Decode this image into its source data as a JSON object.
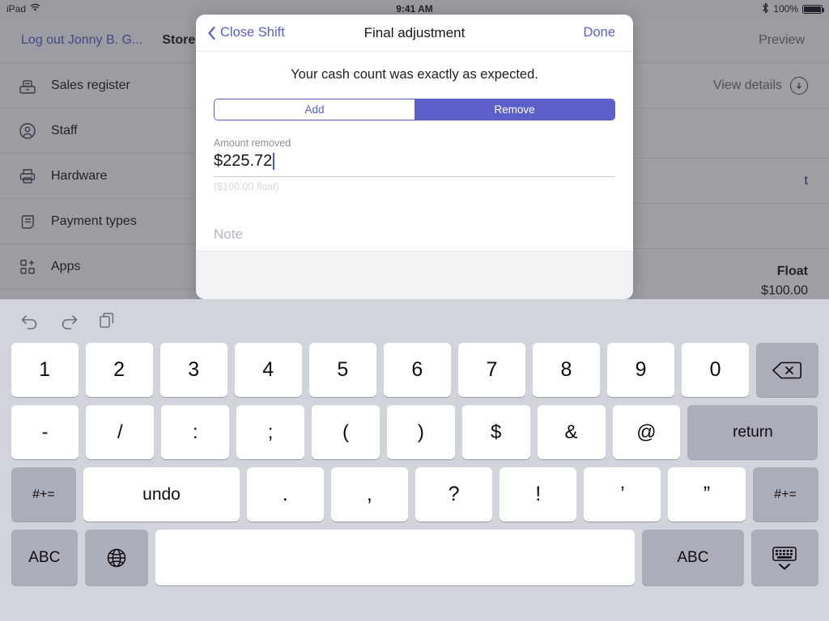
{
  "status_bar": {
    "device": "iPad",
    "wifi_icon": "wifi-icon",
    "time": "9:41 AM",
    "bluetooth_icon": "bluetooth-icon",
    "battery_percent": "100%"
  },
  "nav": {
    "logout": "Log out Jonny B. G...",
    "store": "Store",
    "preview": "Preview"
  },
  "sidebar": {
    "items": [
      {
        "label": "Sales register",
        "icon": "cash-register-icon"
      },
      {
        "label": "Staff",
        "icon": "user-circle-icon"
      },
      {
        "label": "Hardware",
        "icon": "printer-icon"
      },
      {
        "label": "Payment types",
        "icon": "payment-cards-icon"
      },
      {
        "label": "Apps",
        "icon": "apps-grid-plus-icon"
      }
    ]
  },
  "content": {
    "view_details": "View details",
    "view_details_icon": "download-circle-icon",
    "partial_link": "t",
    "float_label": "Float",
    "float_value": "$100.00"
  },
  "modal": {
    "back_label": "Close Shift",
    "back_icon": "chevron-left-icon",
    "title": "Final adjustment",
    "done_label": "Done",
    "message": "Your cash count was exactly as expected.",
    "segment": {
      "options": [
        "Add",
        "Remove"
      ],
      "selected": "Remove"
    },
    "amount_field": {
      "label": "Amount removed",
      "value": "$225.72",
      "hint": "($100.00 float)"
    },
    "note_field": {
      "placeholder": "Note",
      "value": ""
    }
  },
  "keyboard": {
    "tools": [
      {
        "name": "undo-icon"
      },
      {
        "name": "redo-icon"
      },
      {
        "name": "paste-icon"
      }
    ],
    "row_numbers": [
      "1",
      "2",
      "3",
      "4",
      "5",
      "6",
      "7",
      "8",
      "9",
      "0"
    ],
    "backspace_icon": "backspace-icon",
    "row_symbols": [
      "-",
      "/",
      ":",
      ";",
      "(",
      ")",
      "$",
      "&",
      "@"
    ],
    "return_label": "return",
    "row_alt": {
      "left_shift": "#+=",
      "undo": "undo",
      "keys": [
        ".",
        ",",
        "?",
        "!",
        "’",
        "”"
      ],
      "right_shift": "#+="
    },
    "row_bottom": {
      "abc_left": "ABC",
      "globe_icon": "globe-icon",
      "space": "",
      "abc_right": "ABC",
      "hide_icon": "hide-keyboard-icon"
    }
  },
  "colors": {
    "accent": "#5b5fc7",
    "keyboard_bg": "#d1d4db",
    "key_face": "#ffffff",
    "key_dark": "#abaeb8"
  }
}
